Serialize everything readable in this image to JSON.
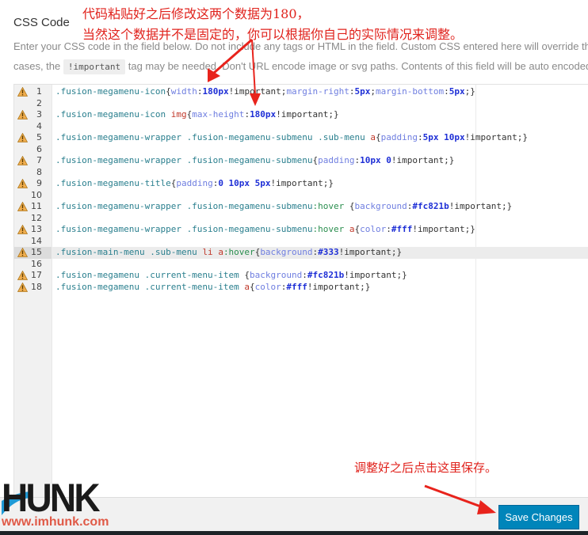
{
  "section": {
    "title": "CSS Code",
    "desc_line1": "Enter your CSS code in the field below. Do not include any tags or HTML in the field. Custom CSS entered here will override the",
    "desc_line2_pre": "cases, the ",
    "desc_code": "!important",
    "desc_line2_post": " tag may be needed. Don't URL encode image or svg paths. Contents of this field will be auto encoded"
  },
  "editor": {
    "active_line": 15,
    "lines": [
      {
        "n": "1",
        "warn": true,
        "tokens": [
          [
            "sel",
            ".fusion-megamenu-icon"
          ],
          [
            "brace",
            "{"
          ],
          [
            "prop",
            "width"
          ],
          [
            "kw",
            ":"
          ],
          [
            "num",
            "180px"
          ],
          [
            "kw",
            "!important;"
          ],
          [
            "prop",
            "margin-right"
          ],
          [
            "kw",
            ":"
          ],
          [
            "num",
            "5px"
          ],
          [
            "kw",
            ";"
          ],
          [
            "prop",
            "margin-bottom"
          ],
          [
            "kw",
            ":"
          ],
          [
            "num",
            "5px"
          ],
          [
            "kw",
            ";}"
          ]
        ]
      },
      {
        "n": "2",
        "warn": false,
        "tokens": []
      },
      {
        "n": "3",
        "warn": true,
        "tokens": [
          [
            "sel",
            ".fusion-megamenu-icon "
          ],
          [
            "tag",
            "img"
          ],
          [
            "brace",
            "{"
          ],
          [
            "prop",
            "max-height"
          ],
          [
            "kw",
            ":"
          ],
          [
            "num",
            "180px"
          ],
          [
            "kw",
            "!important;}"
          ]
        ]
      },
      {
        "n": "4",
        "warn": false,
        "tokens": []
      },
      {
        "n": "5",
        "warn": true,
        "tokens": [
          [
            "sel",
            ".fusion-megamenu-wrapper .fusion-megamenu-submenu .sub-menu "
          ],
          [
            "tag",
            "a"
          ],
          [
            "brace",
            "{"
          ],
          [
            "prop",
            "padding"
          ],
          [
            "kw",
            ":"
          ],
          [
            "num",
            "5px 10px"
          ],
          [
            "kw",
            "!important;}"
          ]
        ]
      },
      {
        "n": "6",
        "warn": false,
        "tokens": []
      },
      {
        "n": "7",
        "warn": true,
        "tokens": [
          [
            "sel",
            ".fusion-megamenu-wrapper .fusion-megamenu-submenu"
          ],
          [
            "brace",
            "{"
          ],
          [
            "prop",
            "padding"
          ],
          [
            "kw",
            ":"
          ],
          [
            "num",
            "10px 0"
          ],
          [
            "kw",
            "!important;}"
          ]
        ]
      },
      {
        "n": "8",
        "warn": false,
        "tokens": []
      },
      {
        "n": "9",
        "warn": true,
        "tokens": [
          [
            "sel",
            ".fusion-megamenu-title"
          ],
          [
            "brace",
            "{"
          ],
          [
            "prop",
            "padding"
          ],
          [
            "kw",
            ":"
          ],
          [
            "num",
            "0 10px 5px"
          ],
          [
            "kw",
            "!important;}"
          ]
        ]
      },
      {
        "n": "10",
        "warn": false,
        "tokens": []
      },
      {
        "n": "11",
        "warn": true,
        "tokens": [
          [
            "sel",
            ".fusion-megamenu-wrapper .fusion-megamenu-submenu"
          ],
          [
            "pseudo",
            ":hover"
          ],
          [
            "kw",
            " "
          ],
          [
            "brace",
            "{"
          ],
          [
            "prop",
            "background"
          ],
          [
            "kw",
            ":"
          ],
          [
            "num",
            "#fc821b"
          ],
          [
            "kw",
            "!important;}"
          ]
        ]
      },
      {
        "n": "12",
        "warn": false,
        "tokens": []
      },
      {
        "n": "13",
        "warn": true,
        "tokens": [
          [
            "sel",
            ".fusion-megamenu-wrapper .fusion-megamenu-submenu"
          ],
          [
            "pseudo",
            ":hover"
          ],
          [
            "kw",
            " "
          ],
          [
            "tag",
            "a"
          ],
          [
            "brace",
            "{"
          ],
          [
            "prop",
            "color"
          ],
          [
            "kw",
            ":"
          ],
          [
            "num",
            "#fff"
          ],
          [
            "kw",
            "!important;}"
          ]
        ]
      },
      {
        "n": "14",
        "warn": false,
        "tokens": []
      },
      {
        "n": "15",
        "warn": true,
        "tokens": [
          [
            "sel",
            ".fusion-main-menu .sub-menu "
          ],
          [
            "tag",
            "li"
          ],
          [
            "kw",
            " "
          ],
          [
            "tag",
            "a"
          ],
          [
            "pseudo",
            ":hover"
          ],
          [
            "brace",
            "{"
          ],
          [
            "prop",
            "background"
          ],
          [
            "kw",
            ":"
          ],
          [
            "num",
            "#333"
          ],
          [
            "kw",
            "!important;}"
          ]
        ]
      },
      {
        "n": "16",
        "warn": false,
        "tokens": []
      },
      {
        "n": "17",
        "warn": true,
        "tokens": [
          [
            "sel",
            ".fusion-megamenu .current-menu-item "
          ],
          [
            "brace",
            "{"
          ],
          [
            "prop",
            "background"
          ],
          [
            "kw",
            ":"
          ],
          [
            "num",
            "#fc821b"
          ],
          [
            "kw",
            "!important;}"
          ]
        ]
      },
      {
        "n": "18",
        "warn": true,
        "tokens": [
          [
            "sel",
            ".fusion-megamenu .current-menu-item "
          ],
          [
            "tag",
            "a"
          ],
          [
            "brace",
            "{"
          ],
          [
            "prop",
            "color"
          ],
          [
            "kw",
            ":"
          ],
          [
            "num",
            "#fff"
          ],
          [
            "kw",
            "!important;}"
          ]
        ]
      }
    ]
  },
  "annotations": {
    "top_line1": "代码粘贴好之后修改这两个数据为180，",
    "top_line2": "当然这个数据并不是固定的，你可以根据你自己的实际情况来调整。",
    "bottom": "调整好之后点击这里保存。"
  },
  "actions": {
    "save_label": "Save Changes"
  },
  "watermark": {
    "brand": "HUNK",
    "url": "www.imhunk.com"
  },
  "colors": {
    "accent": "#0085ba",
    "annotation": "#e0221c",
    "warning": "#f0ad4e"
  }
}
